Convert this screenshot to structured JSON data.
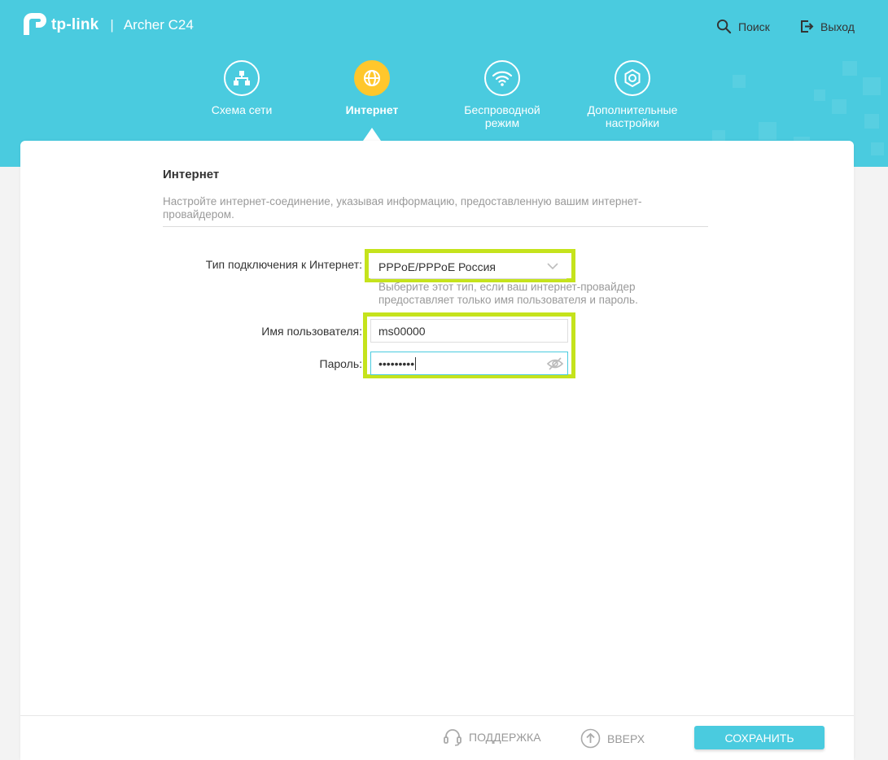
{
  "brand": {
    "logo_text": "tp-link",
    "separator": "|",
    "model": "Archer C24"
  },
  "top_actions": {
    "search_label": "Поиск",
    "logout_label": "Выход"
  },
  "nav": {
    "network_map": "Схема сети",
    "internet": "Интернет",
    "wireless_line1": "Беспроводной",
    "wireless_line2": "режим",
    "advanced_line1": "Дополнительные",
    "advanced_line2": "настройки",
    "active": "internet"
  },
  "section": {
    "title": "Интернет",
    "description": "Настройте интернет-соединение, указывая информацию, предоставленную вашим интернет-провайдером."
  },
  "form": {
    "connection_type_label": "Тип подключения к Интернет:",
    "connection_type_value": "PPPoE/PPPoE Россия",
    "connection_type_hint": "Выберите этот тип, если ваш интернет-провайдер предоставляет только имя пользователя и пароль.",
    "username_label": "Имя пользователя:",
    "username_value": "ms00000",
    "password_label": "Пароль:",
    "password_masked": "•••••••••"
  },
  "footer": {
    "support_label": "ПОДДЕРЖКА",
    "top_label": "ВВЕРХ",
    "save_label": "СОХРАНИТЬ"
  },
  "colors": {
    "accent": "#4acbdf",
    "active_nav": "#ffc72c",
    "highlight": "#c5e31c"
  }
}
